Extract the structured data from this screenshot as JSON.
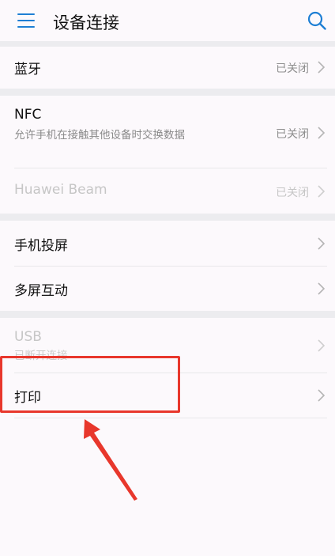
{
  "header": {
    "title": "设备连接",
    "menu_icon": "hamburger-menu-icon",
    "search_icon": "search-icon"
  },
  "items": {
    "bluetooth": {
      "label": "蓝牙",
      "status": "已关闭"
    },
    "nfc": {
      "label": "NFC",
      "desc": "允许手机在接触其他设备时交换数据",
      "status": "已关闭"
    },
    "huawei_beam": {
      "label": "Huawei Beam",
      "status": "已关闭"
    },
    "screen_projection": {
      "label": "手机投屏"
    },
    "multi_screen": {
      "label": "多屏互动"
    },
    "usb": {
      "label": "USB",
      "desc": "已断开连接"
    },
    "print": {
      "label": "打印"
    }
  },
  "annotation": {
    "highlight_color": "#e8372c",
    "target": "print"
  },
  "colors": {
    "accent": "#1e7fd4",
    "background": "#fcf9fc",
    "divider": "#ececef"
  }
}
